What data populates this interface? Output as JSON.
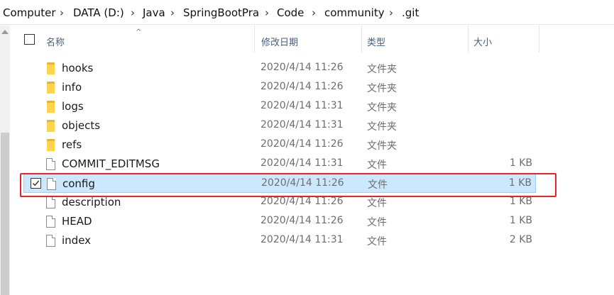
{
  "breadcrumb": {
    "items": [
      "Computer",
      "DATA (D:)",
      "Java",
      "SpringBootPra",
      "Code",
      "community",
      ".git"
    ],
    "separator": "›"
  },
  "columns": {
    "name": "名称",
    "date": "修改日期",
    "type": "类型",
    "size": "大小"
  },
  "files": [
    {
      "name": "hooks",
      "date": "2020/4/14 11:26",
      "type": "文件夹",
      "size": "",
      "icon": "folder-icon"
    },
    {
      "name": "info",
      "date": "2020/4/14 11:26",
      "type": "文件夹",
      "size": "",
      "icon": "folder-icon"
    },
    {
      "name": "logs",
      "date": "2020/4/14 11:31",
      "type": "文件夹",
      "size": "",
      "icon": "folder-icon"
    },
    {
      "name": "objects",
      "date": "2020/4/14 11:31",
      "type": "文件夹",
      "size": "",
      "icon": "folder-icon"
    },
    {
      "name": "refs",
      "date": "2020/4/14 11:26",
      "type": "文件夹",
      "size": "",
      "icon": "folder-icon"
    },
    {
      "name": "COMMIT_EDITMSG",
      "date": "2020/4/14 11:31",
      "type": "文件",
      "size": "1 KB",
      "icon": "file-icon"
    },
    {
      "name": "config",
      "date": "2020/4/14 11:26",
      "type": "文件",
      "size": "1 KB",
      "icon": "file-icon",
      "selected": true
    },
    {
      "name": "description",
      "date": "2020/4/14 11:26",
      "type": "文件",
      "size": "1 KB",
      "icon": "file-icon"
    },
    {
      "name": "HEAD",
      "date": "2020/4/14 11:26",
      "type": "文件",
      "size": "1 KB",
      "icon": "file-icon"
    },
    {
      "name": "index",
      "date": "2020/4/14 11:31",
      "type": "文件",
      "size": "2 KB",
      "icon": "file-icon"
    }
  ],
  "colors": {
    "selection_bg": "#cce8ff",
    "selection_border": "#99d1ff",
    "highlight_box": "#e3242b",
    "folder": "#ffd54f"
  }
}
